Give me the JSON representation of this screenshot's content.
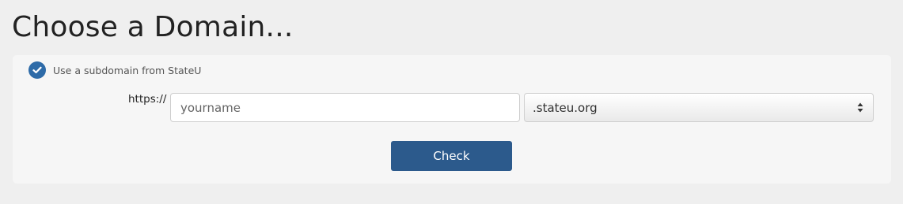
{
  "page": {
    "title": "Choose a Domain..."
  },
  "subdomain_option": {
    "label": "Use a subdomain from StateU",
    "checked": true,
    "icon": "check-circle-icon",
    "accent_color": "#2e6ba8"
  },
  "form": {
    "protocol_label": "https://",
    "subdomain_placeholder": "yourname",
    "subdomain_value": "",
    "domain_select": {
      "selected": ".stateu.org",
      "icon": "select-arrows-icon"
    },
    "check_button_label": "Check",
    "check_button_color": "#2c5a8c"
  }
}
